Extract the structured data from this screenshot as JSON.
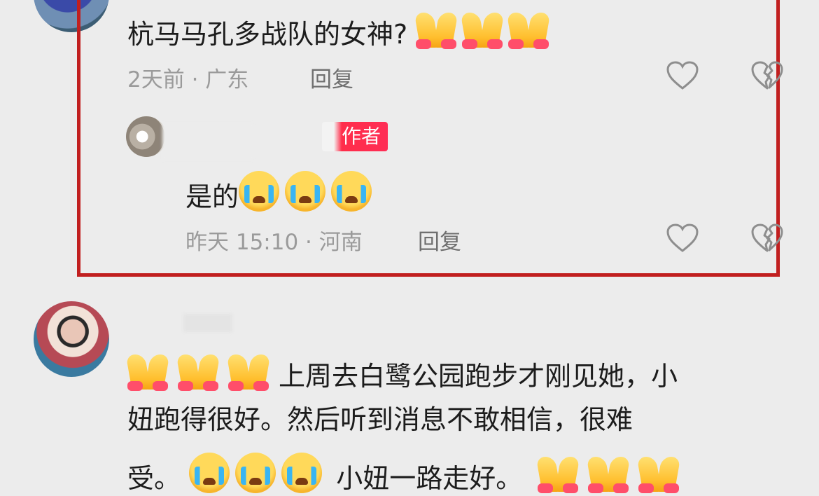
{
  "comment1": {
    "text": "杭马马孔多战队的女神?",
    "meta": "2天前 · 广东",
    "reply_label": "回复",
    "emojis": [
      "folded-hands",
      "folded-hands",
      "folded-hands"
    ]
  },
  "reply1": {
    "author_tag": "作者",
    "text": "是的",
    "emojis": [
      "loudly-crying-face",
      "loudly-crying-face",
      "loudly-crying-face"
    ],
    "meta": "昨天 15:10 · 河南",
    "reply_label": "回复"
  },
  "comment2": {
    "line1": "上周去白鹭公园跑步才刚见她，小",
    "line2": "妞跑得很好。然后听到消息不敢相信，很难",
    "line3_a": "受。",
    "line3_b": "小妞一路走好。",
    "emojis": [
      "folded-hands",
      "loudly-crying-face"
    ]
  },
  "colors": {
    "highlight_border": "#c11f1f",
    "author_tag": "#ff2d55",
    "background": "#ececec"
  },
  "icons": [
    "heart-icon",
    "heart-broken-icon"
  ]
}
